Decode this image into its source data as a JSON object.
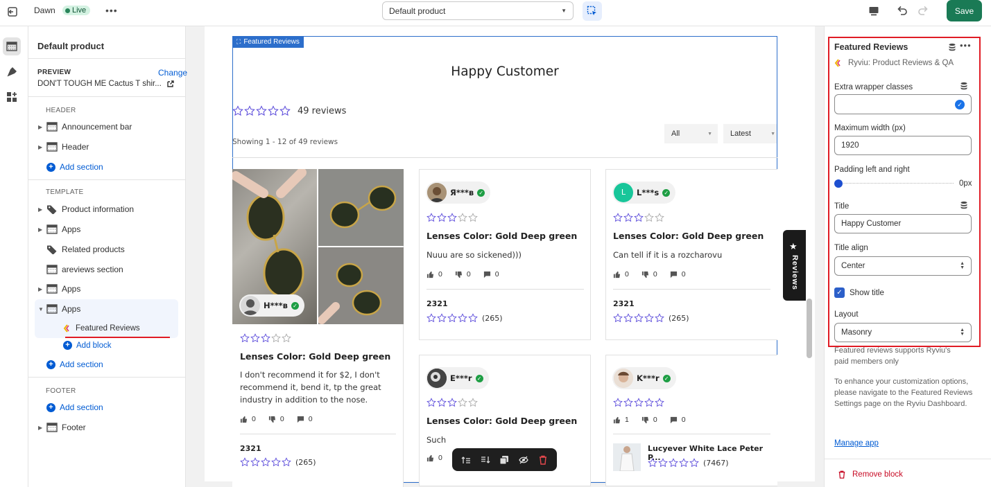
{
  "topbar": {
    "theme_name": "Dawn",
    "live_badge": "Live",
    "template_select": "Default product",
    "save_label": "Save"
  },
  "left_panel": {
    "title": "Default product",
    "preview_label": "PREVIEW",
    "change_link": "Change",
    "preview_product": "DON'T TOUGH ME Cactus T shir...",
    "header_group": "HEADER",
    "header_items": [
      "Announcement bar",
      "Header"
    ],
    "add_section": "Add section",
    "template_group": "TEMPLATE",
    "template_items": [
      "Product information",
      "Apps",
      "Related products",
      "areviews section",
      "Apps",
      "Apps"
    ],
    "block_item": "Featured Reviews",
    "add_block": "Add block",
    "footer_group": "FOOTER",
    "footer_items": [
      "Footer"
    ]
  },
  "preview": {
    "block_tag": "Featured Reviews",
    "heading": "Happy Customer",
    "review_count": "49 reviews",
    "showing": "Showing 1 - 12 of 49 reviews",
    "filter_all": "All",
    "filter_sort": "Latest",
    "side_tab": "Reviews",
    "reviews": [
      {
        "name": "H***в",
        "stars": 3,
        "title": "Lenses Color: Gold Deep green",
        "body": "I don't recommend it for $2, I don't recommend it, bend it, tp the great industry in addition to the nose.",
        "likes": "0",
        "dislikes": "0",
        "comments": "0",
        "product": "2321",
        "product_count": "(265)"
      },
      {
        "name": "Я***в",
        "stars": 3,
        "title": "Lenses Color: Gold Deep green",
        "body": "Nuuu are so sickened)))",
        "likes": "0",
        "dislikes": "0",
        "comments": "0",
        "product": "2321",
        "product_count": "(265)"
      },
      {
        "name": "L***s",
        "avatar_letter": "L",
        "stars": 3,
        "title": "Lenses Color: Gold Deep green",
        "body": "Can tell if it is a rozcharovu",
        "likes": "0",
        "dislikes": "0",
        "comments": "0",
        "product": "2321",
        "product_count": "(265)"
      },
      {
        "name": "E***r",
        "stars": 3,
        "title": "Lenses Color: Gold Deep green",
        "body": "Such",
        "likes": "0"
      },
      {
        "name": "K***r",
        "stars": 5,
        "likes": "1",
        "dislikes": "0",
        "comments": "0",
        "product": "Lucyever White Lace Peter P...",
        "product_count": "(7467)"
      }
    ]
  },
  "right_panel": {
    "title": "Featured Reviews",
    "app_name": "Ryviu: Product Reviews & QA",
    "extra_label": "Extra wrapper classes",
    "extra_value": "",
    "maxw_label": "Maximum width (px)",
    "maxw_value": "1920",
    "padding_label": "Padding left and right",
    "padding_value": "0px",
    "padding_level": 0,
    "title_label": "Title",
    "title_value": "Happy Customer",
    "align_label": "Title align",
    "align_value": "Center",
    "show_title_label": "Show title",
    "show_title": true,
    "layout_label": "Layout",
    "layout_value": "Masonry",
    "note1": "Featured reviews supports Ryviu's paid members only",
    "note2": "To enhance your customization options, please navigate to the Featured Reviews Settings page on the Ryviu Dashboard.",
    "manage_app": "Manage app",
    "remove_block": "Remove block"
  },
  "colors": {
    "accent": "#005bd3",
    "save": "#1a7a55",
    "star": "#5b4bdb",
    "highlight": "#e01b24"
  }
}
